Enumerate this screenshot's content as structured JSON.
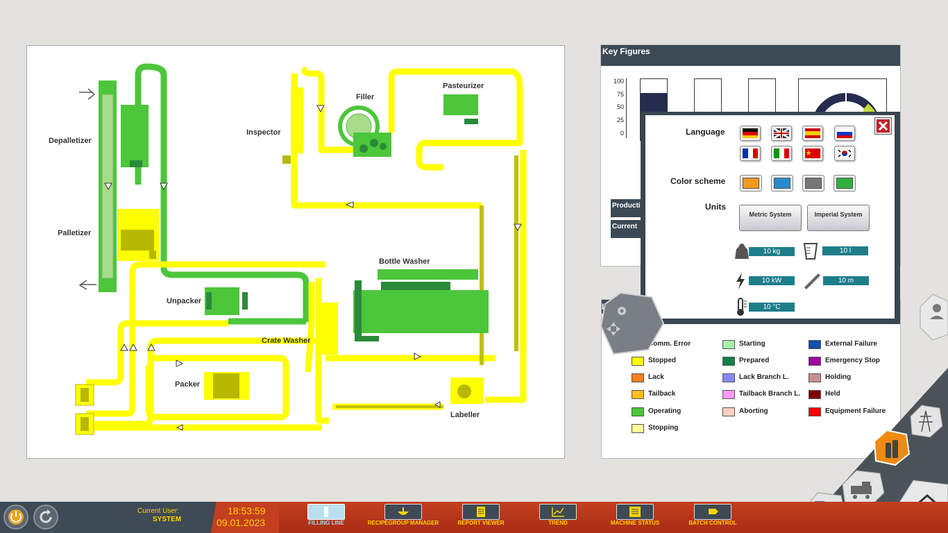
{
  "plant": {
    "labels": {
      "depalletizer": "Depalletizer",
      "palletizer": "Palletizer",
      "inspector": "Inspector",
      "filler": "Filler",
      "pasteurizer": "Pasteurizer",
      "bottle_washer": "Bottle Washer",
      "unpacker": "Unpacker",
      "crate_washer": "Crate Washer",
      "packer": "Packer",
      "labeller": "Labeller"
    }
  },
  "key_figures": {
    "title": "Key Figures",
    "axis_ticks": [
      "100",
      "75",
      "50",
      "25",
      "0"
    ],
    "production_label": "Producti",
    "current_label": "Current"
  },
  "legend": {
    "title": "Le",
    "items": [
      {
        "label": "Comm. Error",
        "color": "#ff3a3a"
      },
      {
        "label": "Stopped",
        "color": "#ffff00"
      },
      {
        "label": "Lack",
        "color": "#ff7f1c"
      },
      {
        "label": "Tailback",
        "color": "#ffbd1a"
      },
      {
        "label": "Operating",
        "color": "#4cc63a"
      },
      {
        "label": "Stopping",
        "color": "#ffff99"
      },
      {
        "label": "Starting",
        "color": "#a8f0a8"
      },
      {
        "label": "Prepared",
        "color": "#13804a"
      },
      {
        "label": "Lack Branch L.",
        "color": "#8888ff"
      },
      {
        "label": "Tailback Branch L.",
        "color": "#ff99ff"
      },
      {
        "label": "Aborting",
        "color": "#ffd0c0"
      },
      {
        "label": "External Failure",
        "color": "#1050b0"
      },
      {
        "label": "Emergency Stop",
        "color": "#a000a0"
      },
      {
        "label": "Holding",
        "color": "#c89090"
      },
      {
        "label": "Held",
        "color": "#800000"
      },
      {
        "label": "Equipment Failure",
        "color": "#ff0000"
      }
    ]
  },
  "settings": {
    "language_label": "Language",
    "color_scheme_label": "Color scheme",
    "units_label": "Units",
    "metric_button": "Metric System",
    "imperial_button": "Imperial System",
    "weight_value": "10 kg",
    "volume_value": "10 l",
    "power_value": "10 kW",
    "length_value": "10 m",
    "temperature_value": "10 °C",
    "color_schemes": [
      "#f09a20",
      "#2a8ad0",
      "#777777",
      "#30b040"
    ]
  },
  "status": {
    "user_label": "Current User:",
    "user_name": "SYSTEM",
    "time": "18:53:59",
    "date": "09.01.2023"
  },
  "toolbar": {
    "filling_line": "FILLING LINE",
    "recipegroup_manager": "RECIPEGROUP MANAGER",
    "report_viewer": "REPORT VIEWER",
    "trend": "TREND",
    "machine_status": "MACHINE STATUS",
    "batch_control": "BATCH CONTROL"
  }
}
